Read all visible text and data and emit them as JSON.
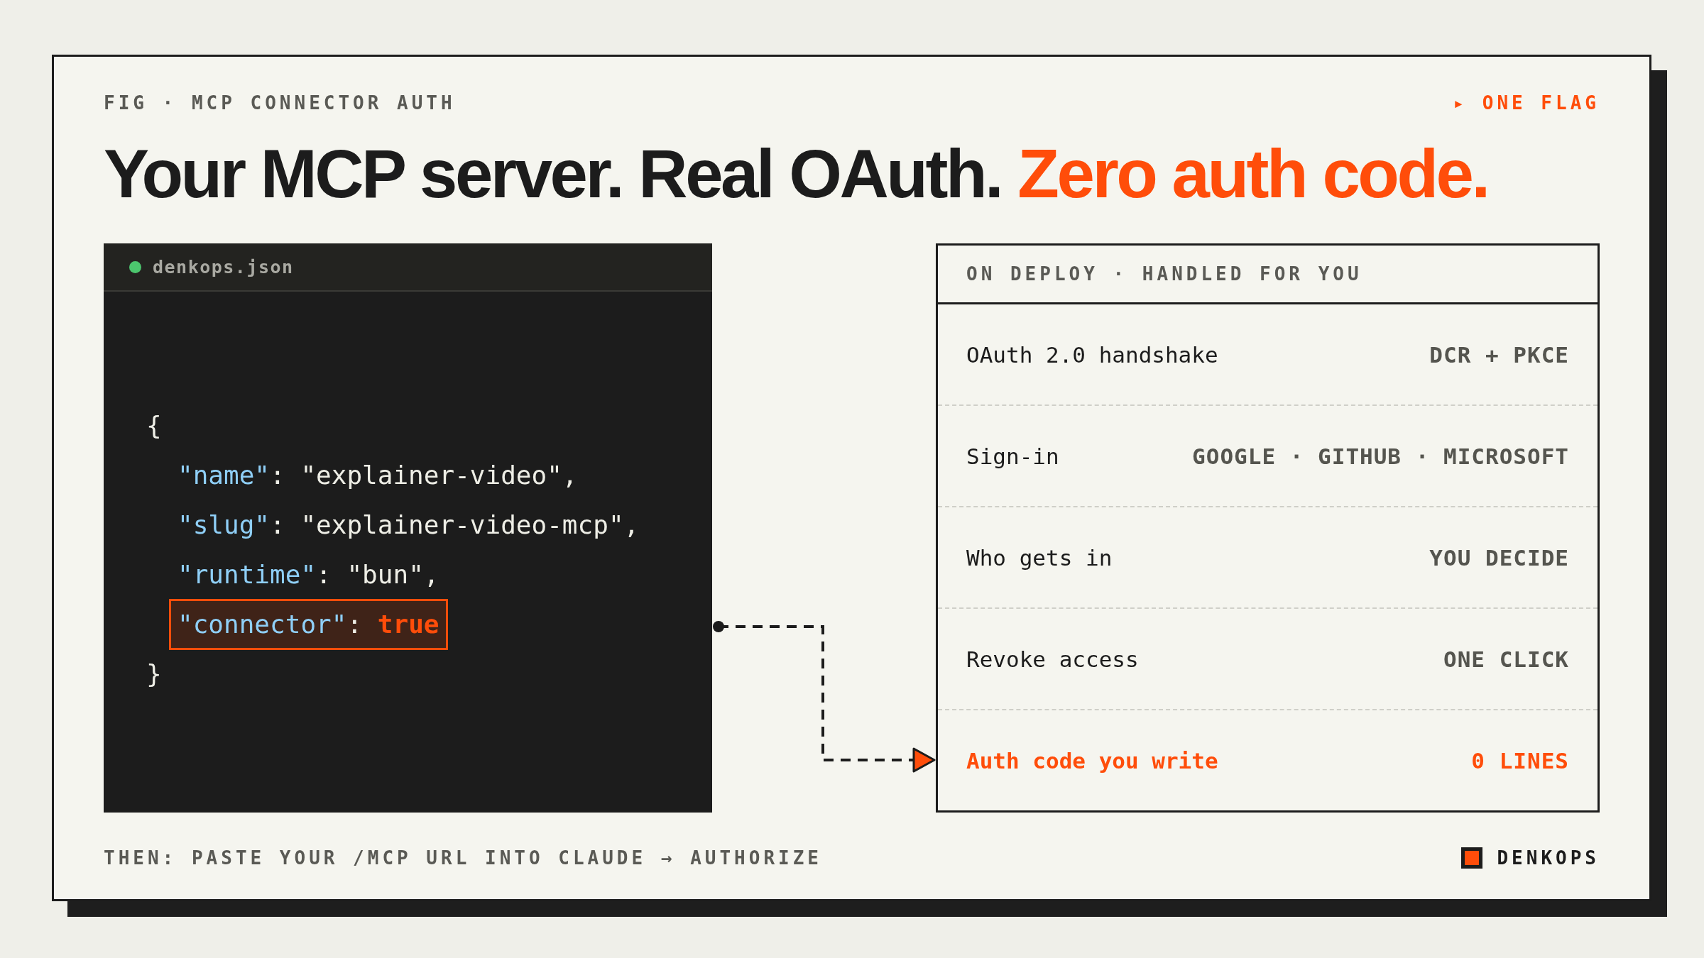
{
  "figure_label": "FIG · MCP CONNECTOR AUTH",
  "flag": "▸ ONE FLAG",
  "headline": {
    "text": "Your MCP server. Real OAuth.",
    "accent": "Zero auth code."
  },
  "code_panel": {
    "filename": "denkops.json",
    "lines": [
      {
        "kind": "brace",
        "text": "{"
      },
      {
        "kind": "pair",
        "key": "\"name\"",
        "sep": ": ",
        "value": "\"explainer-video\",",
        "highlighted": false
      },
      {
        "kind": "pair",
        "key": "\"slug\"",
        "sep": ": ",
        "value": "\"explainer-video-mcp\",",
        "highlighted": false
      },
      {
        "kind": "pair",
        "key": "\"runtime\"",
        "sep": ": ",
        "value": "\"bun\",",
        "highlighted": false
      },
      {
        "kind": "pair",
        "key": "\"connector\"",
        "sep": ": ",
        "value": "true",
        "highlighted": true
      },
      {
        "kind": "brace",
        "text": "}"
      }
    ]
  },
  "table": {
    "header": "ON DEPLOY · HANDLED FOR YOU",
    "rows": [
      {
        "label": "OAuth 2.0 handshake",
        "value": "DCR + PKCE",
        "accent": false
      },
      {
        "label": "Sign-in",
        "value": "GOOGLE · GITHUB · MICROSOFT",
        "accent": false
      },
      {
        "label": "Who gets in",
        "value": "YOU DECIDE",
        "accent": false
      },
      {
        "label": "Revoke access",
        "value": "ONE CLICK",
        "accent": false
      },
      {
        "label": "Auth code you write",
        "value": "0 LINES",
        "accent": true
      }
    ]
  },
  "footer": {
    "note": "THEN: PASTE YOUR /MCP URL INTO CLAUDE → AUTHORIZE",
    "brand": "DENKOPS"
  }
}
